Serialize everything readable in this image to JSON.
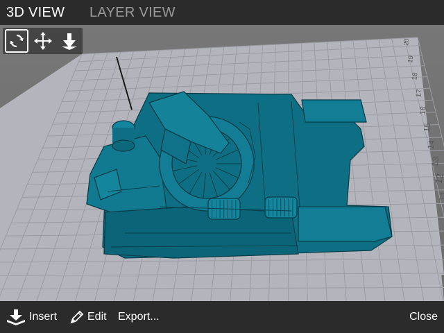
{
  "tabs": {
    "view3d_label": "3D VIEW",
    "layer_label": "LAYER VIEW",
    "active": "3D VIEW"
  },
  "toolbar": {
    "tools": [
      {
        "name": "rotate",
        "icon": "rotate-icon",
        "active": true
      },
      {
        "name": "move",
        "icon": "move-icon",
        "active": false
      },
      {
        "name": "drop",
        "icon": "drop-to-bed-icon",
        "active": false
      }
    ]
  },
  "bed": {
    "ruler_labels": [
      "10",
      "11",
      "12",
      "13",
      "14",
      "15",
      "16",
      "17",
      "18",
      "19",
      "20"
    ],
    "grid_color": "#a9a9a9",
    "plate_color": "#b4b4bc"
  },
  "model": {
    "color": "#0e6f84",
    "edge_color": "#073e4a"
  },
  "bottom": {
    "insert_label": "Insert",
    "edit_label": "Edit",
    "export_label": "Export...",
    "close_label": "Close"
  },
  "colors": {
    "bar_bg": "#2b2b2b",
    "active_text": "#ffffff",
    "inactive_text": "#9a9a9a"
  }
}
